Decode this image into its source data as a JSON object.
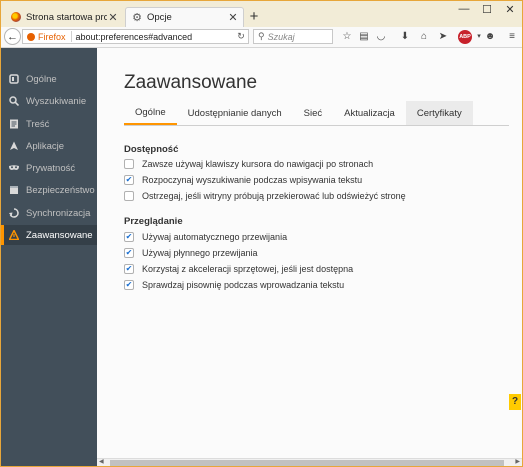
{
  "tabs": [
    {
      "title": "Strona startowa programu Fi",
      "favicon_color": "#e66000"
    },
    {
      "title": "Opcje",
      "favicon": "gear-icon"
    }
  ],
  "nav": {
    "identity_label": "Firefox",
    "url": "about:preferences#advanced",
    "search_placeholder": "Szukaj",
    "abp_label": "ABP"
  },
  "sidebar": {
    "items": [
      {
        "label": "Ogólne",
        "icon": "general-icon"
      },
      {
        "label": "Wyszukiwanie",
        "icon": "search-icon"
      },
      {
        "label": "Treść",
        "icon": "content-icon"
      },
      {
        "label": "Aplikacje",
        "icon": "applications-icon"
      },
      {
        "label": "Prywatność",
        "icon": "privacy-mask-icon"
      },
      {
        "label": "Bezpieczeństwo",
        "icon": "security-icon"
      },
      {
        "label": "Synchronizacja",
        "icon": "sync-icon"
      },
      {
        "label": "Zaawansowane",
        "icon": "advanced-icon",
        "active": true
      }
    ]
  },
  "main": {
    "title": "Zaawansowane",
    "subtabs": [
      {
        "label": "Ogólne",
        "active": true
      },
      {
        "label": "Udostępnianie danych"
      },
      {
        "label": "Sieć"
      },
      {
        "label": "Aktualizacja"
      },
      {
        "label": "Certyfikaty"
      }
    ],
    "sections": [
      {
        "title": "Dostępność",
        "options": [
          {
            "label": "Zawsze używaj klawiszy kursora do nawigacji po stronach",
            "checked": false
          },
          {
            "label": "Rozpoczynaj wyszukiwanie podczas wpisywania tekstu",
            "checked": true
          },
          {
            "label": "Ostrzegaj, jeśli witryny próbują przekierować lub odświeżyć stronę",
            "checked": false
          }
        ]
      },
      {
        "title": "Przeglądanie",
        "options": [
          {
            "label": "Używaj automatycznego przewijania",
            "checked": true
          },
          {
            "label": "Używaj płynnego przewijania",
            "checked": true
          },
          {
            "label": "Korzystaj z akceleracji sprzętowej, jeśli jest dostępna",
            "checked": true
          },
          {
            "label": "Sprawdzaj pisownię podczas wprowadzania tekstu",
            "checked": true
          }
        ]
      }
    ],
    "help_label": "?"
  },
  "colors": {
    "accent": "#ff9500",
    "sidebar_bg": "#424f5a",
    "sidebar_active_bg": "#343f48",
    "window_border": "#e7a63a"
  }
}
